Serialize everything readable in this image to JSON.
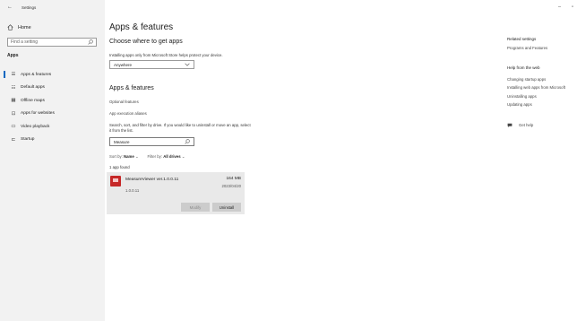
{
  "window": {
    "title": "Settings",
    "back_glyph": "←",
    "minimize_glyph": "–",
    "restore_glyph": "▫"
  },
  "sidebar": {
    "home_label": "Home",
    "search_placeholder": "Find a setting",
    "section": "Apps",
    "items": [
      {
        "label": "Apps & features",
        "icon": "apps-features-icon",
        "glyph": "☰",
        "active": true
      },
      {
        "label": "Default apps",
        "icon": "default-apps-icon",
        "glyph": "☷",
        "active": false
      },
      {
        "label": "Offline maps",
        "icon": "offline-maps-icon",
        "glyph": "▦",
        "active": false
      },
      {
        "label": "Apps for websites",
        "icon": "apps-for-websites-icon",
        "glyph": "⊡",
        "active": false
      },
      {
        "label": "Video playback",
        "icon": "video-playback-icon",
        "glyph": "▭",
        "active": false
      },
      {
        "label": "Startup",
        "icon": "startup-icon",
        "glyph": "⊏",
        "active": false
      }
    ]
  },
  "main": {
    "title": "Apps & features",
    "choose_heading": "Choose where to get apps",
    "choose_desc": "Installing apps only from Microsoft Store helps protect your device.",
    "source_dropdown": "Anywhere",
    "apps_heading": "Apps & features",
    "optional_features": "Optional features",
    "app_execution_aliases": "App execution aliases",
    "search_desc": "Search, sort, and filter by drive. If you would like to uninstall or move an app, select it from the list.",
    "search_value": "Measure",
    "sort_label": "Sort by:",
    "sort_value": "Name",
    "filter_label": "Filter by:",
    "filter_value": "All drives",
    "found_text": "1 app found",
    "app": {
      "name": "MeasureViewer ver.1.0.0.11",
      "size": "164 MB",
      "date": "2023/04/20",
      "version": "1.0.0.11",
      "modify_label": "Modify",
      "uninstall_label": "Uninstall"
    }
  },
  "right": {
    "related_heading": "Related settings",
    "related_link": "Programs and Features",
    "help_heading": "Help from the web",
    "help_links": [
      "Changing startup apps",
      "Installing web apps from Microsoft",
      "Uninstalling apps",
      "Updating apps"
    ],
    "get_help": "Get help"
  },
  "colors": {
    "sidebar_bg": "#f2f2f2",
    "accent": "#0067c0",
    "card_bg": "#e9e9e9"
  }
}
